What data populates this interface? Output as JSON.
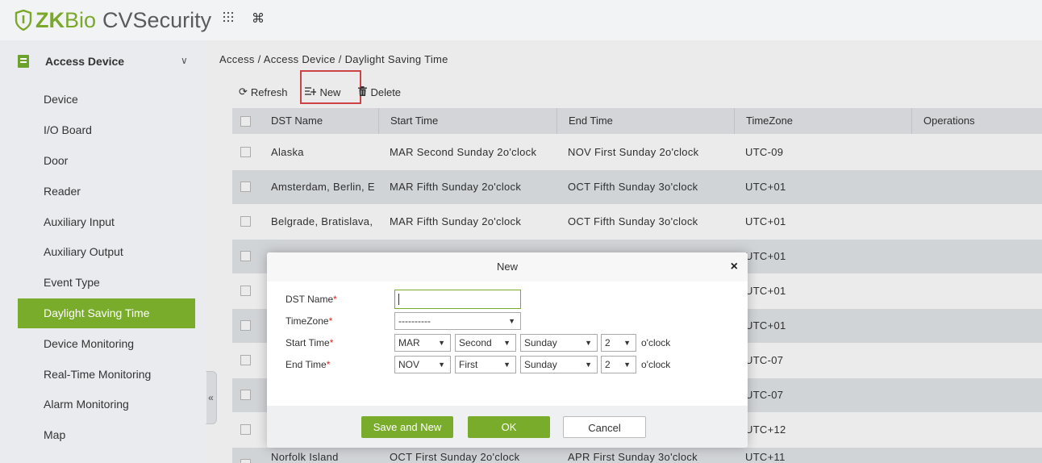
{
  "brand": {
    "zk": "ZK",
    "bio": "Bio",
    "cv": "CVSecurity"
  },
  "topbar": {
    "apps_icon": "grid-dots-icon",
    "cmd_icon": "⌘"
  },
  "sidebar": {
    "module": "Access Device",
    "items": [
      {
        "label": "Device"
      },
      {
        "label": "I/O Board"
      },
      {
        "label": "Door"
      },
      {
        "label": "Reader"
      },
      {
        "label": "Auxiliary Input"
      },
      {
        "label": "Auxiliary Output"
      },
      {
        "label": "Event Type"
      },
      {
        "label": "Daylight Saving Time",
        "active": true
      },
      {
        "label": "Device Monitoring"
      },
      {
        "label": "Real-Time Monitoring"
      },
      {
        "label": "Alarm Monitoring"
      },
      {
        "label": "Map"
      }
    ],
    "collapse_glyph": "«"
  },
  "breadcrumb": "Access / Access Device / Daylight Saving Time",
  "toolbar": {
    "refresh": "Refresh",
    "new": "New",
    "delete": "Delete"
  },
  "table": {
    "headers": [
      "DST Name",
      "Start Time",
      "End Time",
      "TimeZone",
      "Operations"
    ],
    "rows": [
      {
        "name": "Alaska",
        "start": "MAR Second Sunday 2o'clock",
        "end": "NOV First Sunday 2o'clock",
        "tz": "UTC-09"
      },
      {
        "name": "Amsterdam, Berlin, E",
        "start": "MAR Fifth Sunday 2o'clock",
        "end": "OCT Fifth Sunday 3o'clock",
        "tz": "UTC+01"
      },
      {
        "name": "Belgrade, Bratislava,",
        "start": "MAR Fifth Sunday 2o'clock",
        "end": "OCT Fifth Sunday 3o'clock",
        "tz": "UTC+01"
      },
      {
        "name": "",
        "start": "",
        "end": "",
        "tz": "UTC+01"
      },
      {
        "name": "",
        "start": "",
        "end": "",
        "tz": "UTC+01"
      },
      {
        "name": "",
        "start": "",
        "end": "",
        "tz": "UTC+01"
      },
      {
        "name": "",
        "start": "",
        "end": "",
        "tz": "UTC-07"
      },
      {
        "name": "",
        "start": "",
        "end": "",
        "tz": "UTC-07"
      },
      {
        "name": "",
        "start": "",
        "end": "",
        "tz": "UTC+12"
      },
      {
        "name": "Norfolk Island",
        "start": "OCT First Sunday 2o'clock",
        "end": "APR First Sunday 3o'clock",
        "tz": "UTC+11"
      }
    ]
  },
  "dialog": {
    "title": "New",
    "close": "×",
    "labels": {
      "dst_name": "DST Name",
      "timezone": "TimeZone",
      "start_time": "Start Time",
      "end_time": "End Time",
      "required_mark": "*"
    },
    "dst_name_value": "",
    "timezone_value": "----------",
    "start": {
      "month": "MAR",
      "week": "Second",
      "day": "Sunday",
      "hour": "2"
    },
    "end": {
      "month": "NOV",
      "week": "First",
      "day": "Sunday",
      "hour": "2"
    },
    "oclock": "o'clock",
    "buttons": {
      "save_new": "Save and New",
      "ok": "OK",
      "cancel": "Cancel"
    }
  }
}
